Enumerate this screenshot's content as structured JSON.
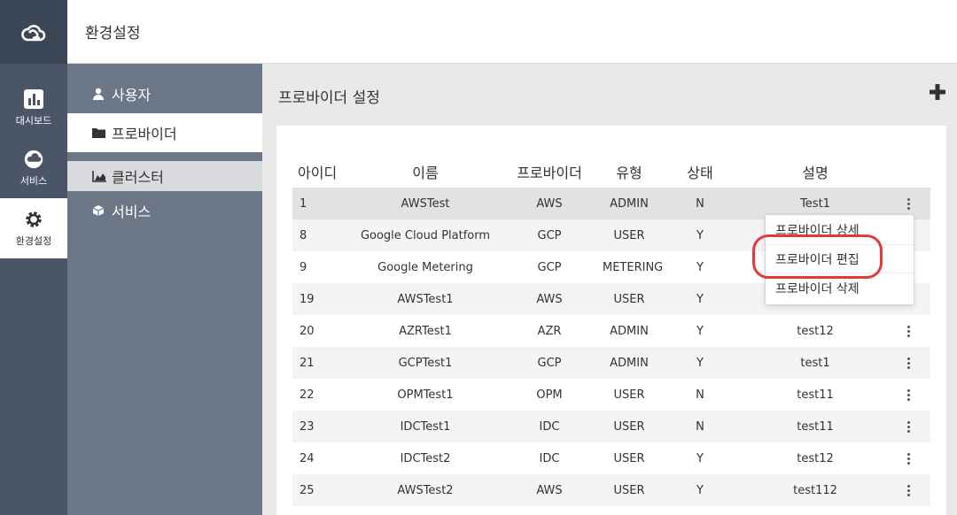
{
  "rail": {
    "items": [
      {
        "label": "대시보드",
        "icon": "bar-chart-icon"
      },
      {
        "label": "서비스",
        "icon": "cloud-icon"
      },
      {
        "label": "환경설정",
        "icon": "gear-icon",
        "active": true
      }
    ]
  },
  "header": {
    "title": "환경설정"
  },
  "subnav": {
    "items": [
      {
        "label": "사용자",
        "icon": "user-icon"
      },
      {
        "label": "프로바이더",
        "icon": "folder-icon",
        "active": true
      },
      {
        "label": "클러스터",
        "icon": "area-chart-icon"
      },
      {
        "label": "서비스",
        "icon": "cube-icon"
      }
    ]
  },
  "main": {
    "title": "프로바이더 설정",
    "add_icon": "plus-icon"
  },
  "table": {
    "headers": [
      "아이디",
      "이름",
      "프로바이더",
      "유형",
      "상태",
      "설명"
    ],
    "rows": [
      [
        "1",
        "AWSTest",
        "AWS",
        "ADMIN",
        "N",
        "Test1"
      ],
      [
        "8",
        "Google Cloud Platform",
        "GCP",
        "USER",
        "Y",
        ""
      ],
      [
        "9",
        "Google Metering",
        "GCP",
        "METERING",
        "Y",
        ""
      ],
      [
        "19",
        "AWSTest1",
        "AWS",
        "USER",
        "Y",
        ""
      ],
      [
        "20",
        "AZRTest1",
        "AZR",
        "ADMIN",
        "Y",
        "test12"
      ],
      [
        "21",
        "GCPTest1",
        "GCP",
        "ADMIN",
        "Y",
        "test1"
      ],
      [
        "22",
        "OPMTest1",
        "OPM",
        "USER",
        "N",
        "test11"
      ],
      [
        "23",
        "IDCTest1",
        "IDC",
        "USER",
        "N",
        "test11"
      ],
      [
        "24",
        "IDCTest2",
        "IDC",
        "USER",
        "Y",
        "test12"
      ],
      [
        "25",
        "AWSTest2",
        "AWS",
        "USER",
        "Y",
        "test112"
      ]
    ]
  },
  "dropdown": {
    "items": [
      "프로바이더 상세",
      "프로바이더 편집",
      "프로바이더 삭제"
    ],
    "highlight_color": "#e53935"
  },
  "colors": {
    "rail_bg": "#4a5568",
    "subnav_bg": "#6b7686",
    "highlight": "#e53935"
  }
}
